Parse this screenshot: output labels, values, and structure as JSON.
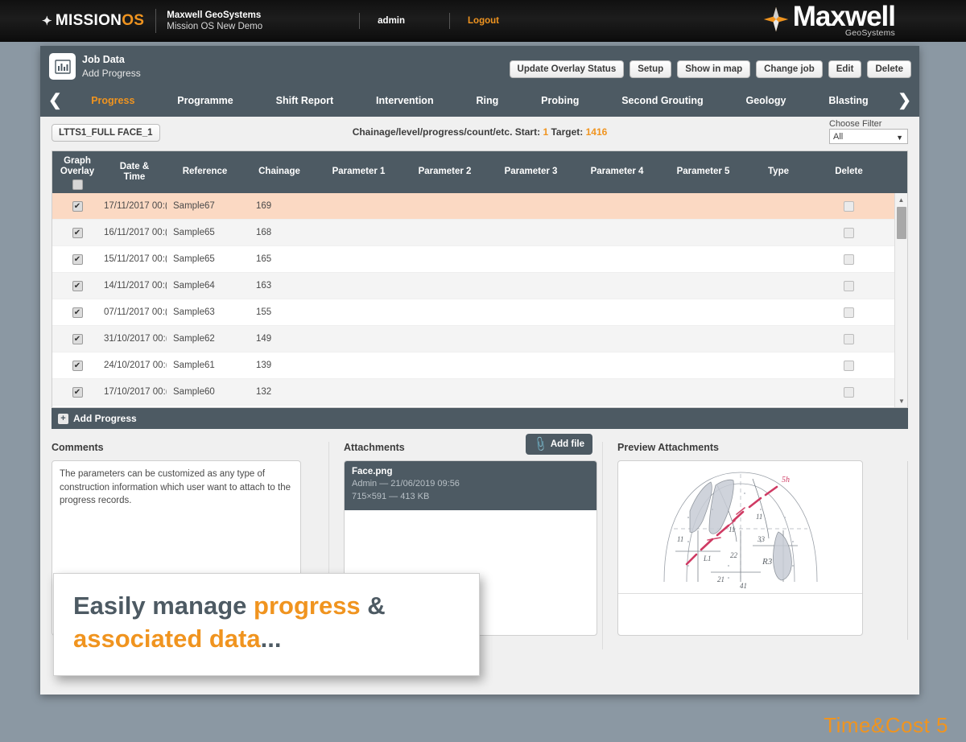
{
  "topbar": {
    "product_white": "MISSION",
    "product_orange": "OS",
    "company": "Maxwell GeoSystems",
    "instance": "Mission OS New Demo",
    "user": "admin",
    "logout": "Logout",
    "brand_name": "Maxwell",
    "brand_sub": "GeoSystems",
    "accent_color": "#f0941f",
    "bar_color": "#141414"
  },
  "toolbar": {
    "icon": "bar-chart-icon",
    "title": "Job Data",
    "subtitle": "Add Progress",
    "buttons": [
      "Update Overlay Status",
      "Setup",
      "Show in map",
      "Change job",
      "Edit",
      "Delete"
    ],
    "prev_arrow": "❮",
    "next_arrow": "❯",
    "tabs": [
      {
        "label": "Progress",
        "active": true
      },
      {
        "label": "Programme",
        "active": false
      },
      {
        "label": "Shift Report",
        "active": false
      },
      {
        "label": "Intervention",
        "active": false
      },
      {
        "label": "Ring",
        "active": false
      },
      {
        "label": "Probing",
        "active": false
      },
      {
        "label": "Second Grouting",
        "active": false
      },
      {
        "label": "Geology",
        "active": false
      },
      {
        "label": "Blasting",
        "active": false
      }
    ]
  },
  "filterbar": {
    "face_button": "LTTS1_FULL FACE_1",
    "chainage_prefix": "Chainage/level/progress/count/etc. Start:",
    "chainage_start": "1",
    "chainage_target_label": "Target:",
    "chainage_target": "1416",
    "filter_label": "Choose Filter",
    "filter_value": "All",
    "filter_caret": "▼"
  },
  "table": {
    "headers": {
      "graph_overlay": "Graph\nOverlay",
      "graph_overlay_l1": "Graph",
      "graph_overlay_l2": "Overlay",
      "date_time_l1": "Date &",
      "date_time_l2": "Time",
      "reference": "Reference",
      "chainage": "Chainage",
      "parameter_1": "Parameter 1",
      "parameter_2": "Parameter 2",
      "parameter_3": "Parameter 3",
      "parameter_4": "Parameter 4",
      "parameter_5": "Parameter 5",
      "type": "Type",
      "delete": "Delete"
    },
    "check_glyph": "✔",
    "rows": [
      {
        "overlay": true,
        "datetime": "17/11/2017 00:(",
        "reference": "Sample67",
        "chainage": "169",
        "p1": "",
        "p2": "",
        "p3": "",
        "p4": "",
        "p5": "",
        "type": "",
        "delete": false,
        "selected": true
      },
      {
        "overlay": true,
        "datetime": "16/11/2017 00:(",
        "reference": "Sample65",
        "chainage": "168",
        "p1": "",
        "p2": "",
        "p3": "",
        "p4": "",
        "p5": "",
        "type": "",
        "delete": false,
        "selected": false
      },
      {
        "overlay": true,
        "datetime": "15/11/2017 00:(",
        "reference": "Sample65",
        "chainage": "165",
        "p1": "",
        "p2": "",
        "p3": "",
        "p4": "",
        "p5": "",
        "type": "",
        "delete": false,
        "selected": false
      },
      {
        "overlay": true,
        "datetime": "14/11/2017 00:(",
        "reference": "Sample64",
        "chainage": "163",
        "p1": "",
        "p2": "",
        "p3": "",
        "p4": "",
        "p5": "",
        "type": "",
        "delete": false,
        "selected": false
      },
      {
        "overlay": true,
        "datetime": "07/11/2017 00:(",
        "reference": "Sample63",
        "chainage": "155",
        "p1": "",
        "p2": "",
        "p3": "",
        "p4": "",
        "p5": "",
        "type": "",
        "delete": false,
        "selected": false
      },
      {
        "overlay": true,
        "datetime": "31/10/2017 00:(",
        "reference": "Sample62",
        "chainage": "149",
        "p1": "",
        "p2": "",
        "p3": "",
        "p4": "",
        "p5": "",
        "type": "",
        "delete": false,
        "selected": false
      },
      {
        "overlay": true,
        "datetime": "24/10/2017 00:(",
        "reference": "Sample61",
        "chainage": "139",
        "p1": "",
        "p2": "",
        "p3": "",
        "p4": "",
        "p5": "",
        "type": "",
        "delete": false,
        "selected": false
      },
      {
        "overlay": true,
        "datetime": "17/10/2017 00:(",
        "reference": "Sample60",
        "chainage": "132",
        "p1": "",
        "p2": "",
        "p3": "",
        "p4": "",
        "p5": "",
        "type": "",
        "delete": false,
        "selected": false
      }
    ],
    "scroll_up": "▲",
    "scroll_down": "▼",
    "add_row_label": "Add Progress",
    "add_row_icon": "+"
  },
  "comments": {
    "title": "Comments",
    "text": "The parameters can be customized as any type of construction information which user want to attach to the progress records."
  },
  "attachments": {
    "title": "Attachments",
    "add_file_label": "Add file",
    "add_file_icon": "paperclip-icon",
    "items": [
      {
        "name": "Face.png",
        "meta_owner": "Admin — 21/06/2019 09:56",
        "meta_size": "715×591 — 413 KB"
      }
    ]
  },
  "preview": {
    "title": "Preview Attachments",
    "image_alt": "tunnel-face-sketch"
  },
  "callout": {
    "line1_plain": "Easily manage ",
    "line1_hl": "progress",
    "line1_tail": " &",
    "line2_hl": "associated data",
    "line2_tail": "...",
    "highlight_color": "#f0941f",
    "text_color": "#4d5a63"
  },
  "footer": {
    "label": "Time&Cost  5"
  }
}
